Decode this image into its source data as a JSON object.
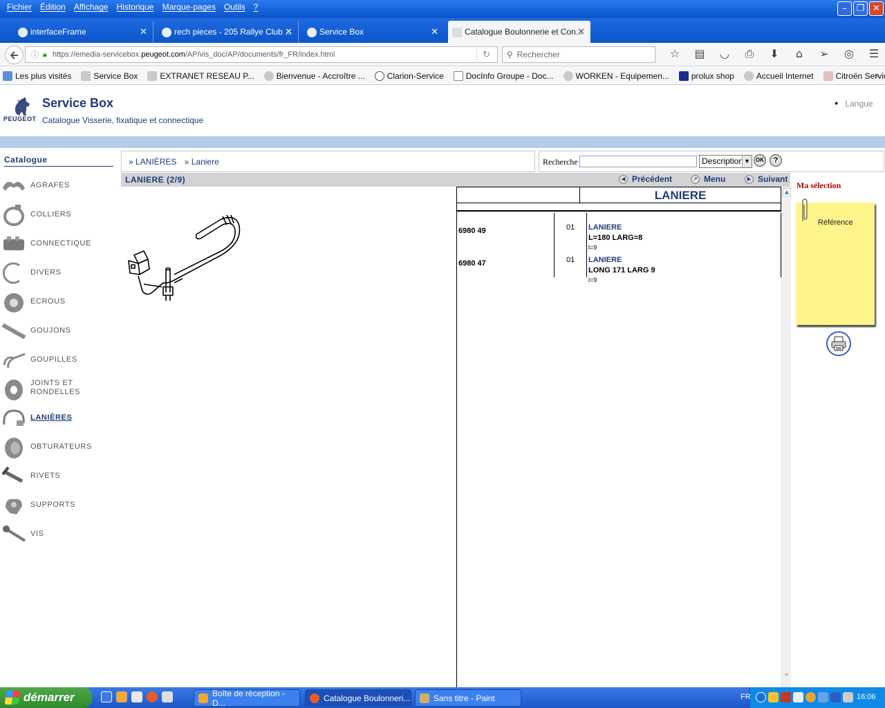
{
  "browser": {
    "menu": [
      "Fichier",
      "Édition",
      "Affichage",
      "Historique",
      "Marque-pages",
      "Outils",
      "?"
    ],
    "tabs": [
      {
        "label": "interfaceFrame"
      },
      {
        "label": "rech pieces - 205 Rallye Club ..."
      },
      {
        "label": "Service Box"
      },
      {
        "label": "Catalogue Boulonnerie et Con..."
      }
    ],
    "url_prefix": "https://emedia-servicebox.",
    "url_domain": "peugeot.com",
    "url_suffix": "/AP/vis_doc/AP/documents/fr_FR/index.html",
    "search_placeholder": "Rechercher",
    "bookmarks": [
      "Les plus visités",
      "Service Box",
      "EXTRANET RESEAU P...",
      "Bienvenue - Accroître ...",
      "Clarion-Service",
      "DocInfo Groupe - Doc...",
      "WORKEN - Equipemen...",
      "prolux shop",
      "Accueil Internet",
      "Citroën Service"
    ]
  },
  "header": {
    "title": "Service Box",
    "subtitle": "Catalogue Visserie, fixatique et connectique",
    "logo_text": "PEUGEOT",
    "langue": "Langue"
  },
  "sidebar": {
    "title": "Catalogue",
    "items": [
      {
        "label": "AGRAFES"
      },
      {
        "label": "COLLIERS"
      },
      {
        "label": "CONNECTIQUE"
      },
      {
        "label": "DIVERS"
      },
      {
        "label": "ECROUS"
      },
      {
        "label": "GOUJONS"
      },
      {
        "label": "GOUPILLES"
      },
      {
        "label": "JOINTS ET"
      },
      {
        "label": "LANIÈRES"
      },
      {
        "label": "OBTURATEURS"
      },
      {
        "label": "RIVETS"
      },
      {
        "label": "SUPPORTS"
      },
      {
        "label": "VIS"
      }
    ],
    "joints_line2": "RONDELLES"
  },
  "breadcrumb": [
    "» LANIÈRES",
    "» Laniere"
  ],
  "search": {
    "label": "Recherche",
    "value": "",
    "select": "Description",
    "ok": "OK",
    "help": "?"
  },
  "content": {
    "title": "LANIERE (2/9)",
    "prev": "Précédent",
    "menu": "Menu",
    "next": "Suivant",
    "table_title": "LANIERE",
    "rows": [
      {
        "ref": "6980 49",
        "qty": "01",
        "name": "LANIERE",
        "desc": "L=180 LARG=8",
        "note": "l=9"
      },
      {
        "ref": "6980 47",
        "qty": "01",
        "name": "LANIERE",
        "desc": "LONG 171 LARG 9",
        "note": "l=9"
      }
    ]
  },
  "selection": {
    "title": "Ma sélection",
    "note_label": "Référence"
  },
  "taskbar": {
    "start": "démarrer",
    "tasks": [
      "Boîte de réception - D...",
      "Catalogue Boulonneri...",
      "Sans titre - Paint"
    ],
    "lang": "FR",
    "clock": "16:06"
  }
}
